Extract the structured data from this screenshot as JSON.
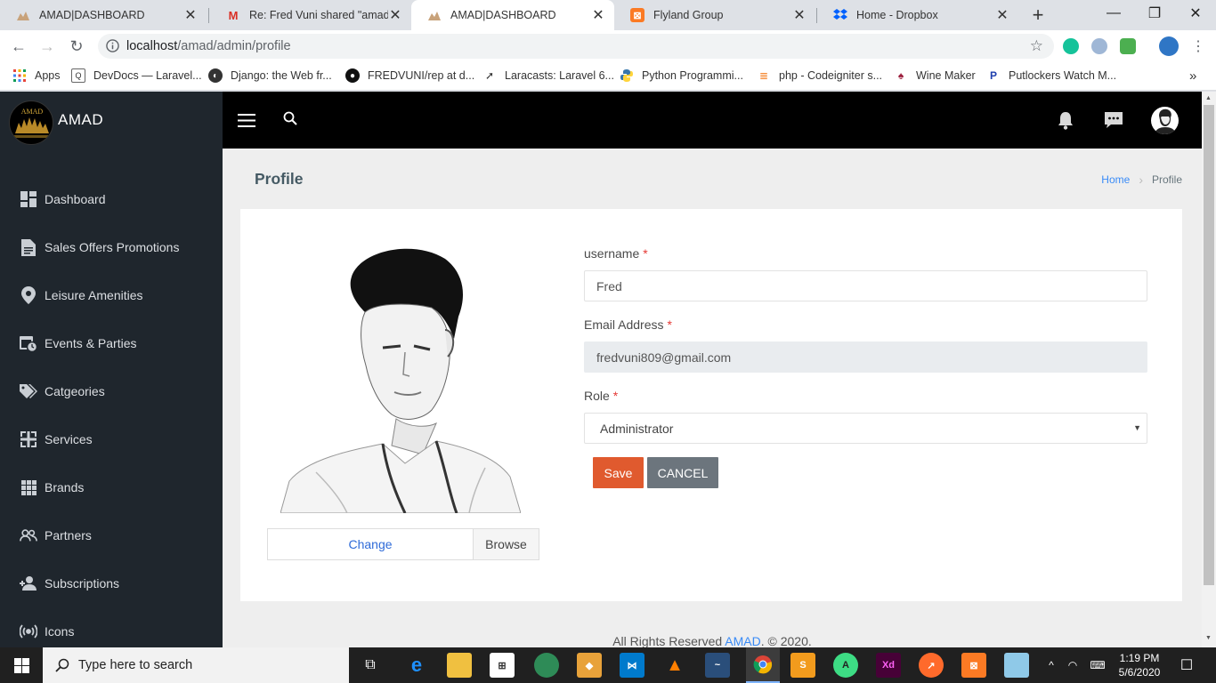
{
  "browser": {
    "tabs": [
      {
        "title": "AMAD|DASHBOARD",
        "icon": "amad-favicon",
        "active": false
      },
      {
        "title": "Re: Fred Vuni shared \"amad.sq",
        "icon": "gmail-icon",
        "active": false
      },
      {
        "title": "AMAD|DASHBOARD",
        "icon": "amad-favicon",
        "active": true
      },
      {
        "title": "Flyland Group",
        "icon": "xampp-icon",
        "active": false
      },
      {
        "title": "Home - Dropbox",
        "icon": "dropbox-icon",
        "active": false
      }
    ],
    "url_host": "localhost",
    "url_path": "/amad/admin/profile",
    "bookmarks": [
      {
        "label": "Apps",
        "icon": "apps-grid-icon"
      },
      {
        "label": "DevDocs — Laravel...",
        "icon": "devdocs-icon"
      },
      {
        "label": "Django: the Web fr...",
        "icon": "globe-icon"
      },
      {
        "label": "FREDVUNI/rep at d...",
        "icon": "github-icon"
      },
      {
        "label": "Laracasts: Laravel 6...",
        "icon": "laracasts-icon"
      },
      {
        "label": "Python Programmi...",
        "icon": "python-icon"
      },
      {
        "label": "php - Codeigniter s...",
        "icon": "stackoverflow-icon"
      },
      {
        "label": "Wine Maker",
        "icon": "wine-icon"
      },
      {
        "label": "Putlockers Watch M...",
        "icon": "putlockers-icon"
      }
    ],
    "more_bookmarks": "»"
  },
  "app": {
    "brand": "AMAD",
    "sidebar": [
      {
        "label": "Dashboard",
        "icon": "dashboard-icon"
      },
      {
        "label": "Sales Offers Promotions",
        "icon": "document-icon"
      },
      {
        "label": "Leisure Amenities",
        "icon": "location-pin-icon"
      },
      {
        "label": "Events & Parties",
        "icon": "calendar-clock-icon"
      },
      {
        "label": "Catgeories",
        "icon": "tags-icon"
      },
      {
        "label": "Services",
        "icon": "services-icon"
      },
      {
        "label": "Brands",
        "icon": "grid-icon"
      },
      {
        "label": "Partners",
        "icon": "users-icon"
      },
      {
        "label": "Subscriptions",
        "icon": "user-plus-icon"
      },
      {
        "label": "Icons",
        "icon": "broadcast-icon"
      }
    ],
    "page_title": "Profile",
    "breadcrumb": {
      "home": "Home",
      "separator": ">",
      "current": "Profile"
    },
    "profile_image": {
      "change_label": "Change",
      "browse_label": "Browse"
    },
    "form": {
      "username_label": "username",
      "username_value": "Fred",
      "email_label": "Email Address",
      "email_value": "fredvuni809@gmail.com",
      "role_label": "Role",
      "role_value": "Administrator",
      "required_mark": "*",
      "save_label": "Save",
      "cancel_label": "CANCEL"
    },
    "footer": {
      "prefix": "All Rights Reserved ",
      "brand": "AMAD",
      "suffix": ". © 2020."
    }
  },
  "taskbar": {
    "search_placeholder": "Type here to search",
    "time": "1:19 PM",
    "date": "5/6/2020"
  },
  "colors": {
    "sidebar_bg": "#1f262d",
    "topbar_bg": "#000000",
    "save_button": "#e05a2e",
    "cancel_button": "#6c757d",
    "link": "#398bf7"
  }
}
